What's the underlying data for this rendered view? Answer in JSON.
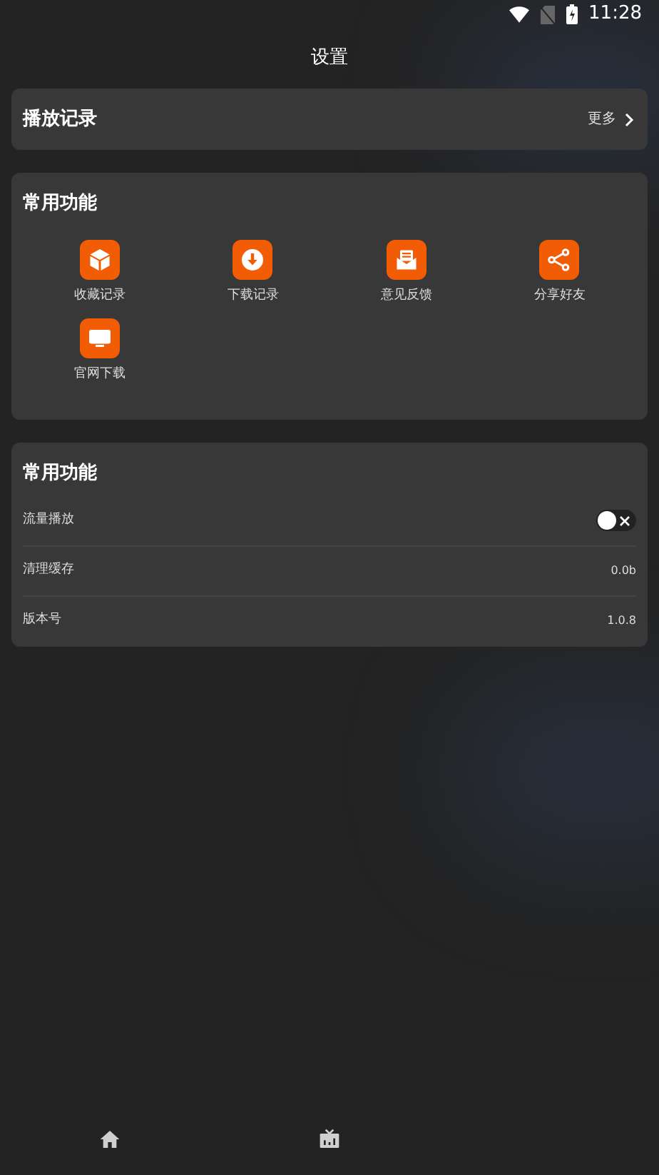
{
  "status_bar": {
    "time": "11:28"
  },
  "header": {
    "title": "设置"
  },
  "history": {
    "title": "播放记录",
    "more": "更多"
  },
  "features": {
    "title": "常用功能",
    "items": [
      {
        "label": "收藏记录",
        "kind": "box"
      },
      {
        "label": "下载记录",
        "kind": "download"
      },
      {
        "label": "意见反馈",
        "kind": "mail"
      },
      {
        "label": "分享好友",
        "kind": "share"
      },
      {
        "label": "官网下载",
        "kind": "monitor"
      }
    ]
  },
  "settings": {
    "title": "常用功能",
    "rows": [
      {
        "label": "流量播放",
        "kind": "switch",
        "on": false
      },
      {
        "label": "清理缓存",
        "kind": "value",
        "value": "0.0b"
      },
      {
        "label": "版本号",
        "kind": "value",
        "value": "1.0.8"
      }
    ]
  },
  "bottom_nav": [
    {
      "kind": "home"
    },
    {
      "kind": "tv"
    }
  ]
}
